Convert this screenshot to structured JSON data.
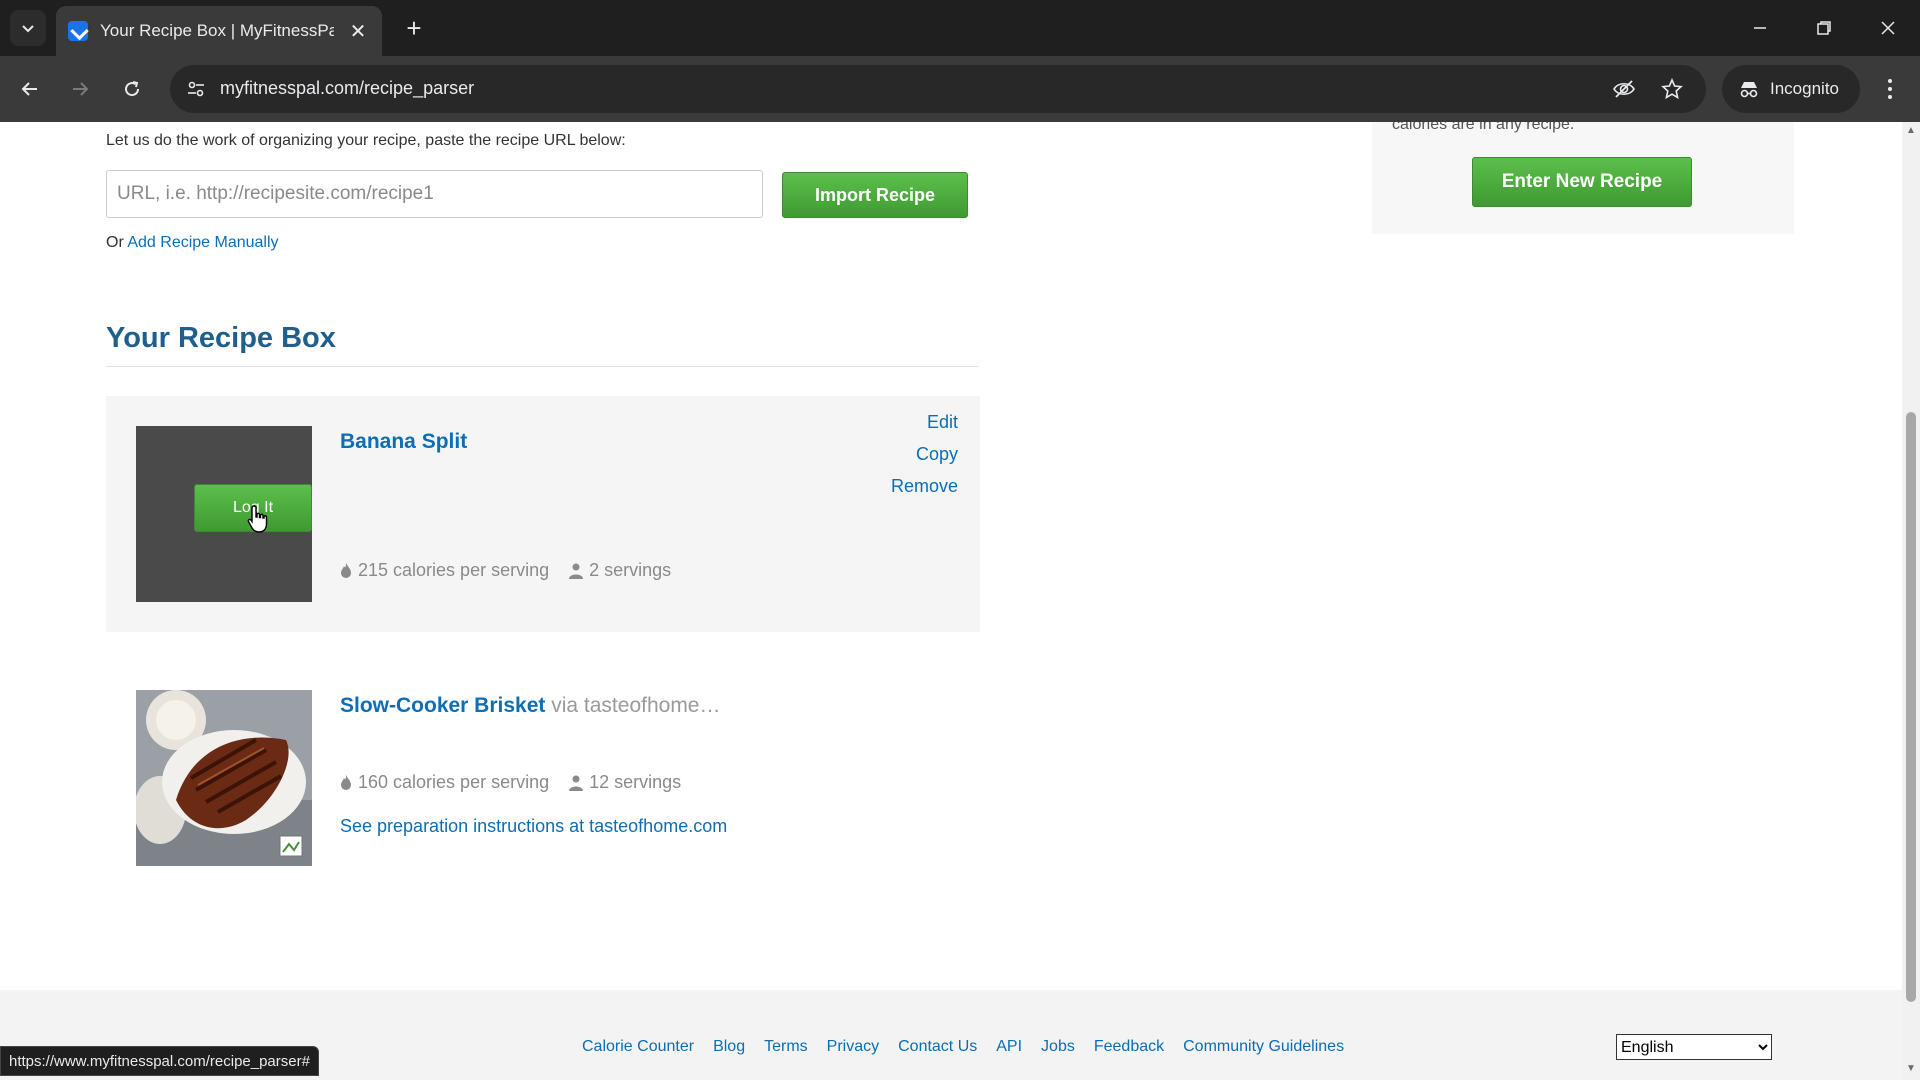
{
  "browser": {
    "tab_title": "Your Recipe Box | MyFitnessPal",
    "url": "myfitnesspal.com/recipe_parser",
    "incognito_label": "Incognito",
    "status_url": "https://www.myfitnesspal.com/recipe_parser#"
  },
  "importer": {
    "intro": "Let us do the work of organizing your recipe, paste the recipe URL below:",
    "url_placeholder": "URL, i.e. http://recipesite.com/recipe1",
    "import_label": "Import Recipe",
    "or_text": "Or",
    "manual_link": "Add Recipe Manually"
  },
  "side_panel": {
    "text": "calories are in any recipe.",
    "enter_label": "Enter New Recipe"
  },
  "recipe_box": {
    "title": "Your Recipe Box",
    "recipes": [
      {
        "name": "Banana Split",
        "calories": "215 calories per serving",
        "servings": "2 servings",
        "log_label": "Log It",
        "actions": [
          "Edit",
          "Copy",
          "Remove"
        ]
      },
      {
        "name": "Slow-Cooker Brisket",
        "source": "via tasteofhome…",
        "calories": "160 calories per serving",
        "servings": "12 servings",
        "prep_link": "See preparation instructions at tasteofhome.com"
      }
    ]
  },
  "footer": {
    "links": [
      "Calorie Counter",
      "Blog",
      "Terms",
      "Privacy",
      "Contact Us",
      "API",
      "Jobs",
      "Feedback",
      "Community Guidelines"
    ],
    "language": "English"
  },
  "colors": {
    "accent_green": "#4cae3c",
    "link_blue": "#0c6eb4",
    "heading_blue": "#1f5f8b"
  }
}
